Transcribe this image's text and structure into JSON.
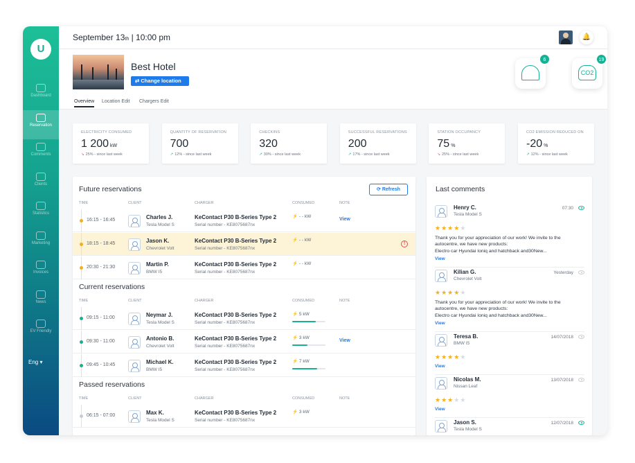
{
  "sidebar": {
    "logo": "U",
    "items": [
      {
        "label": "Dashboard",
        "icon": "dashboard-icon"
      },
      {
        "label": "Reservation",
        "icon": "calendar-icon",
        "active": true
      },
      {
        "label": "Comments",
        "icon": "comment-icon"
      },
      {
        "label": "Clients",
        "icon": "clients-icon"
      },
      {
        "label": "Statistics",
        "icon": "chart-icon"
      },
      {
        "label": "Marketing",
        "icon": "target-icon"
      },
      {
        "label": "Invoices",
        "icon": "invoice-icon"
      },
      {
        "label": "News",
        "icon": "news-icon"
      },
      {
        "label": "EV Friendly",
        "icon": "car-icon"
      }
    ],
    "language": "Eng"
  },
  "topbar": {
    "date_prefix": "September 13",
    "date_suffix": "th",
    "time": " | 10:00 pm"
  },
  "header": {
    "hotel_name": "Best Hotel",
    "change_location": "Change location",
    "tabs": [
      "Overview",
      "Location Edit",
      "Chargers Edit"
    ],
    "eco_trees": {
      "icon": "tree-icon",
      "count": "6"
    },
    "eco_co2": {
      "icon": "co2-cloud-icon",
      "label": "CO2",
      "count": "19"
    }
  },
  "stats": [
    {
      "label": "ELECTRICITY CONSUMED",
      "value": "1 200",
      "unit": "kW",
      "change": "25%",
      "direction": "down",
      "since": " - since last week"
    },
    {
      "label": "QUANTITY OF RESERVATION",
      "value": "700",
      "unit": "",
      "change": "12%",
      "direction": "up",
      "since": " - since last week"
    },
    {
      "label": "CHECKINS",
      "value": "320",
      "unit": "",
      "change": "30%",
      "direction": "up",
      "since": " - since last week"
    },
    {
      "label": "SUCCESSFUL RESERVATIONS",
      "value": "200",
      "unit": "",
      "change": "17%",
      "direction": "up",
      "since": " - since last week"
    },
    {
      "label": "STATION OCCUPANCY",
      "value": "75",
      "unit": "%",
      "change": "25%",
      "direction": "down",
      "since": " - since last week"
    },
    {
      "label": "CO2 EMISSION REDUCED ON",
      "value": "-20",
      "unit": "%",
      "change": "12%",
      "direction": "up",
      "since": " - since last week"
    }
  ],
  "reservations": {
    "refresh_label": "Refresh",
    "columns": [
      "TIME",
      "CLIENT",
      "CHARGER",
      "CONSUMED",
      "NOTE"
    ],
    "sections": [
      {
        "title": "Future reservations",
        "rows": [
          {
            "time": "16:15 - 16:45",
            "name": "Charles J.",
            "car": "Tesla Model S",
            "charger": "KeContact P30 B-Series Type 2",
            "serial": "Serial number - KE8075687nx",
            "consumed": "- - kW",
            "note": "View",
            "dot": "#f2b01e"
          },
          {
            "time": "18:15 - 18:45",
            "name": "Jason K.",
            "car": "Chevrolet Volt",
            "charger": "KeContact P30 B-Series Type 2",
            "serial": "Serial number - KE8075687nx",
            "consumed": "- - kW",
            "note": "",
            "dot": "#f2b01e",
            "highlight": true,
            "alert": "!"
          },
          {
            "time": "20:30 - 21:30",
            "name": "Martin P.",
            "car": "BMW I5",
            "charger": "KeContact P30 B-Series Type 2",
            "serial": "Serial number - KE8075687nx",
            "consumed": "- - kW",
            "note": "",
            "dot": "#f2b01e"
          }
        ]
      },
      {
        "title": "Current reservations",
        "rows": [
          {
            "time": "09:15 - 11:00",
            "name": "Neymar J.",
            "car": "Tesla Model S",
            "charger": "KeContact P30 B-Series Type 2",
            "serial": "Serial number - KE8075687nx",
            "consumed": "5 kW",
            "progress": 0.7,
            "note": "",
            "dot": "#16b093"
          },
          {
            "time": "09:30 - 11:00",
            "name": "Antonio B.",
            "car": "Chevrolet Volt",
            "charger": "KeContact P30 B-Series Type 2",
            "serial": "Serial number - KE8075687nx",
            "consumed": "3 kW",
            "progress": 0.45,
            "note": "View",
            "dot": "#16b093"
          },
          {
            "time": "09:45 - 10:45",
            "name": "Michael K.",
            "car": "BMW I5",
            "charger": "KeContact P30 B-Series Type 2",
            "serial": "Serial number - KE8075687nx",
            "consumed": "7 kW",
            "progress": 0.75,
            "note": "",
            "dot": "#16b093"
          }
        ]
      },
      {
        "title": "Passed reservations",
        "rows": [
          {
            "time": "06:15 - 07:00",
            "name": "Max K.",
            "car": "Tesla Model S",
            "charger": "KeContact P30 B-Series Type 2",
            "serial": "Serial number - KE8075687nx",
            "consumed": "3 kW",
            "note": "",
            "dot": "#c6ccd3"
          }
        ]
      }
    ]
  },
  "comments": {
    "title": "Last comments",
    "view_label": "View",
    "items": [
      {
        "name": "Henry C.",
        "car": "Tesla Model S",
        "when": "07:30",
        "seen": true,
        "rating": 4,
        "text": "Thank you for your appreciation of our work! We invite to the autocentre, we have new products:\nElectro car Hyundai Ioniq and hatchback and30New..."
      },
      {
        "name": "Kilian G.",
        "car": "Chevrolet Volt",
        "when": "Yesterday",
        "seen": false,
        "rating": 4,
        "text": "Thank you for your appreciation of our work! We invite to the autocentre, we have new products:\nElectro car Hyundai Ioniq and hatchback and30New..."
      },
      {
        "name": "Teresa B.",
        "car": "BMW I5",
        "when": "14/07/2018",
        "seen": false,
        "rating": 4,
        "text": ""
      },
      {
        "name": "Nicolas M.",
        "car": "Nissan Leaf",
        "when": "13/07/2018",
        "seen": false,
        "rating": 3,
        "text": ""
      },
      {
        "name": "Jason S.",
        "car": "Tesla Model S",
        "when": "12/07/2018",
        "seen": true,
        "rating": 0,
        "text": ""
      }
    ]
  },
  "colors": {
    "accent": "#16b093",
    "link": "#1f7bea",
    "warning": "#f2b01e",
    "alert": "#e24c4b"
  }
}
